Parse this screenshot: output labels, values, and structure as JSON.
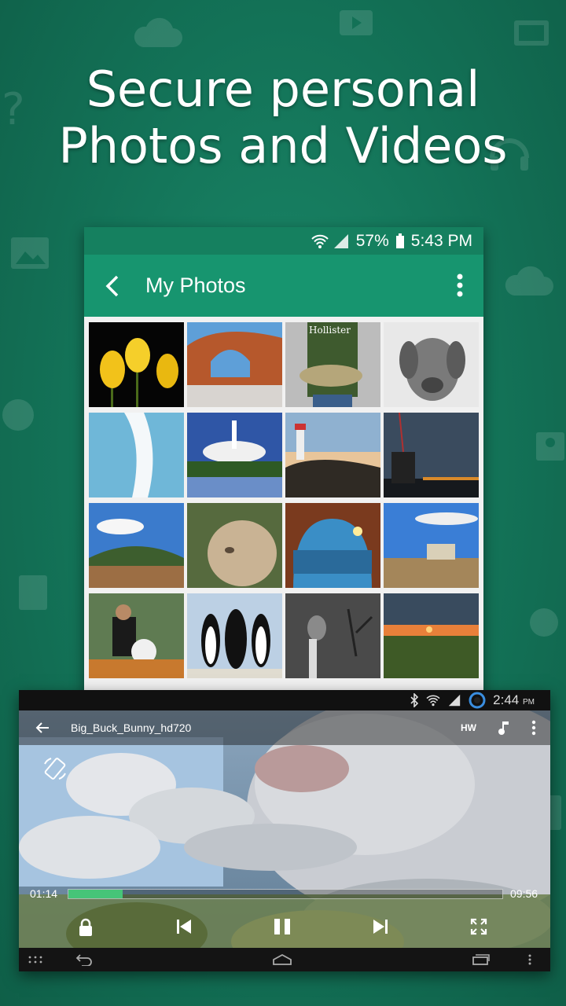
{
  "headline": {
    "line1": "Secure personal",
    "line2": "Photos and Videos"
  },
  "photos_screen": {
    "status_bar": {
      "battery": "57%",
      "time": "5:43 PM"
    },
    "app_bar": {
      "title": "My Photos"
    },
    "thumbnails": [
      "tulips",
      "rock-arch",
      "fish-catch",
      "dog",
      "ice-wall",
      "shuttle-launch",
      "lighthouse",
      "observatory-night",
      "hill-landscape",
      "lioness",
      "sea-cave",
      "farm-house",
      "baseball-kid",
      "penguins",
      "cat-tree",
      "sunset-field"
    ]
  },
  "video_screen": {
    "status_bar": {
      "time": "2:44",
      "ampm": "PM"
    },
    "toolbar": {
      "title": "Big_Buck_Bunny_hd720",
      "hw_label": "HW"
    },
    "progress": {
      "elapsed": "01:14",
      "total": "09:56",
      "fraction": 0.125
    }
  },
  "colors": {
    "accent_green": "#17956f",
    "progress_green": "#46c478",
    "status_green": "#15805f"
  }
}
